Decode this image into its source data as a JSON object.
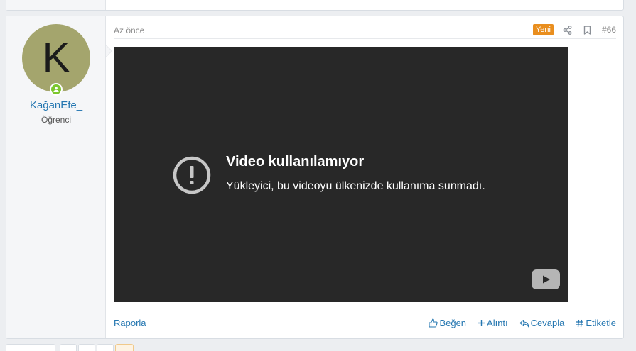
{
  "post": {
    "user": {
      "avatar_letter": "K",
      "avatar_color": "#a4a56d",
      "username": "KağanEfe_",
      "title": "Öğrenci",
      "online": true
    },
    "time": "Az önce",
    "new_badge": "Yeni",
    "number": "#66",
    "header_icons": [
      "share-icon",
      "bookmark-icon"
    ],
    "video": {
      "error_title": "Video kullanılamıyor",
      "error_message": "Yükleyici, bu videoyu ülkenizde kullanıma sunmadı."
    },
    "footer": {
      "report": "Raporla",
      "actions": {
        "like": "Beğen",
        "quote": "Alıntı",
        "reply": "Cevapla",
        "tag": "Etiketle"
      }
    }
  },
  "colors": {
    "link": "#2577b1",
    "new_badge": "#e98e1e",
    "online": "#7cc72e",
    "video_bg": "#282828"
  }
}
